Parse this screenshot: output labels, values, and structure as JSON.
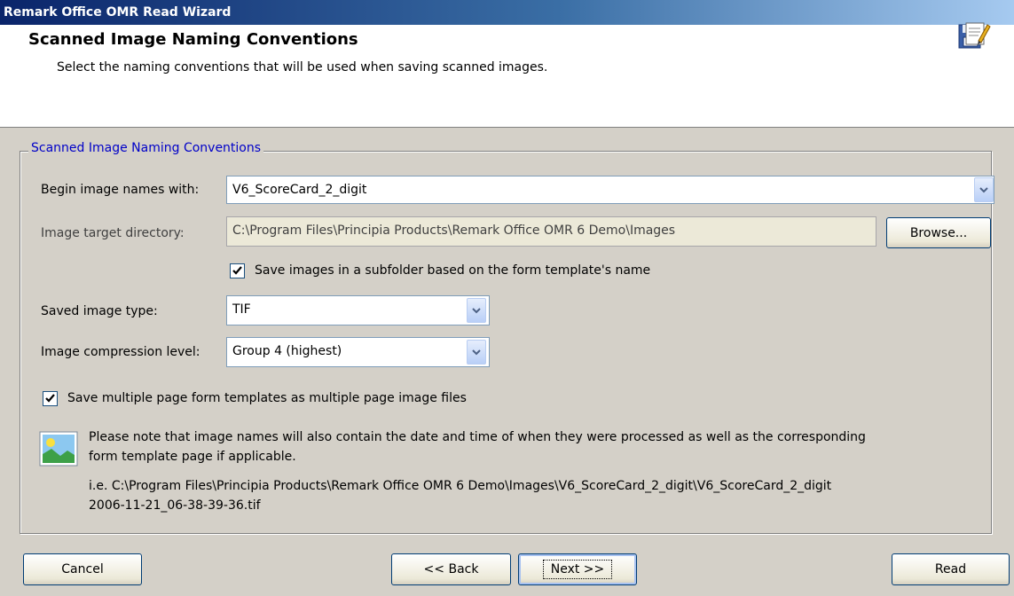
{
  "window": {
    "title": "Remark Office OMR Read Wizard"
  },
  "header": {
    "title": "Scanned Image Naming Conventions",
    "subtitle": "Select the naming conventions that will be used when saving scanned images.",
    "icon": "save-edit-icon"
  },
  "group": {
    "legend": "Scanned Image Naming Conventions",
    "begin_label": "Begin image names with:",
    "begin_value": "V6_ScoreCard_2_digit",
    "target_label": "Image target directory:",
    "target_value": "C:\\Program Files\\Principia Products\\Remark Office OMR 6 Demo\\Images",
    "browse_label": "Browse...",
    "subfolder_label": "Save images in a subfolder based on the form template's name",
    "subfolder_checked": true,
    "type_label": "Saved image type:",
    "type_value": "TIF",
    "compression_label": "Image compression level:",
    "compression_value": "Group 4 (highest)",
    "multipage_label": "Save multiple page form templates as multiple page image files",
    "multipage_checked": true,
    "note_text": "Please note that image names will also contain the date and time of when they were processed as well as the corresponding",
    "note_text_2": "form template page if applicable.",
    "example_line1": "i.e. C:\\Program Files\\Principia Products\\Remark Office OMR 6 Demo\\Images\\V6_ScoreCard_2_digit\\V6_ScoreCard_2_digit",
    "example_line2": "2006-11-21_06-38-39-36.tif",
    "note_icon": "image-icon"
  },
  "buttons": {
    "cancel": "Cancel",
    "back": "<< Back",
    "next": "Next >>",
    "read": "Read"
  },
  "colors": {
    "accent": "#0a246a",
    "legend": "#0000c8",
    "face": "#d4d0c8"
  }
}
